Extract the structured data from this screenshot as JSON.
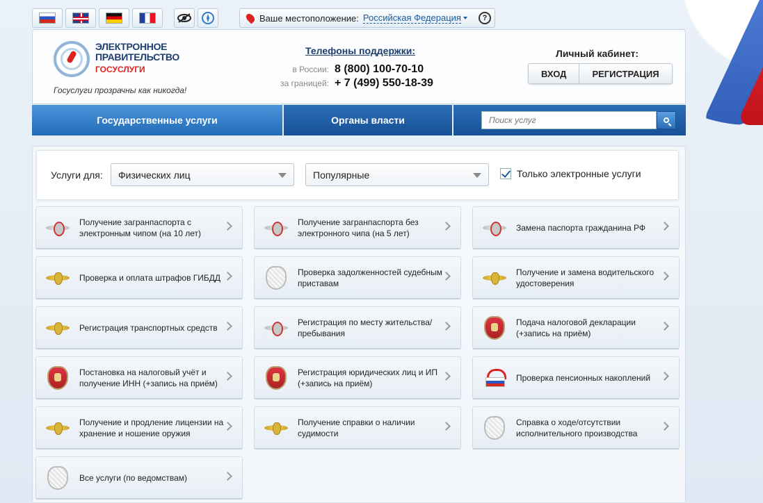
{
  "top": {
    "languages": [
      "ru",
      "en",
      "de",
      "fr"
    ],
    "location_label": "Ваше местоположение:",
    "location_value": "Российская Федерация",
    "help": "?"
  },
  "header": {
    "logo_line1": "ЭЛЕКТРОННОЕ",
    "logo_line2": "ПРАВИТЕЛЬСТВО",
    "logo_line3": "ГОСУСЛУГИ",
    "tagline": "Госуслуги прозрачны как никогда!",
    "support_title": "Телефоны поддержки:",
    "phone_ru_label": "в России:",
    "phone_ru": "8 (800) 100-70-10",
    "phone_abroad_label": "за границей:",
    "phone_abroad": "+ 7 (499) 550-18-39",
    "cabinet_title": "Личный кабинет:",
    "login": "ВХОД",
    "register": "РЕГИСТРАЦИЯ"
  },
  "nav": {
    "tab1": "Государственные услуги",
    "tab2": "Органы власти",
    "search_placeholder": "Поиск услуг"
  },
  "filter": {
    "label": "Услуги для:",
    "audience": "Физических лиц",
    "category": "Популярные",
    "only_electronic": "Только электронные услуги"
  },
  "services": [
    {
      "text": "Получение загранпаспорта с электронным чипом (на 10 лет)",
      "icon": "eagle-grey-icon"
    },
    {
      "text": "Получение загранпаспорта без электронного чипа (на 5 лет)",
      "icon": "eagle-grey-icon"
    },
    {
      "text": "Замена паспорта гражданина РФ",
      "icon": "eagle-grey-icon"
    },
    {
      "text": "Проверка и оплата штрафов ГИБДД",
      "icon": "eagle-gold-icon"
    },
    {
      "text": "Проверка задолженностей судебным приставам",
      "icon": "crest-outline-icon"
    },
    {
      "text": "Получение и замена водительского удостоверения",
      "icon": "eagle-gold-icon"
    },
    {
      "text": "Регистрация транспортных средств",
      "icon": "eagle-gold-icon"
    },
    {
      "text": "Регистрация по месту жительства/пребывания",
      "icon": "eagle-grey-icon"
    },
    {
      "text": "Подача налоговой декларации (+запись на приём)",
      "icon": "tax-crest-icon"
    },
    {
      "text": "Постановка на налоговый учёт и получение ИНН (+запись на приём)",
      "icon": "tax-crest-icon"
    },
    {
      "text": "Регистрация юридических лиц и ИП (+запись на приём)",
      "icon": "tax-crest-icon"
    },
    {
      "text": "Проверка пенсионных накоплений",
      "icon": "pension-fund-icon"
    },
    {
      "text": "Получение и продление лицензии на хранение и ношение оружия",
      "icon": "eagle-gold-icon"
    },
    {
      "text": "Получение справки о наличии судимости",
      "icon": "eagle-gold-icon"
    },
    {
      "text": "Справка о ходе/отсутствии исполнительного производства",
      "icon": "crest-outline-icon"
    },
    {
      "text": "Все услуги (по ведомствам)",
      "icon": "crest-outline-icon"
    }
  ]
}
